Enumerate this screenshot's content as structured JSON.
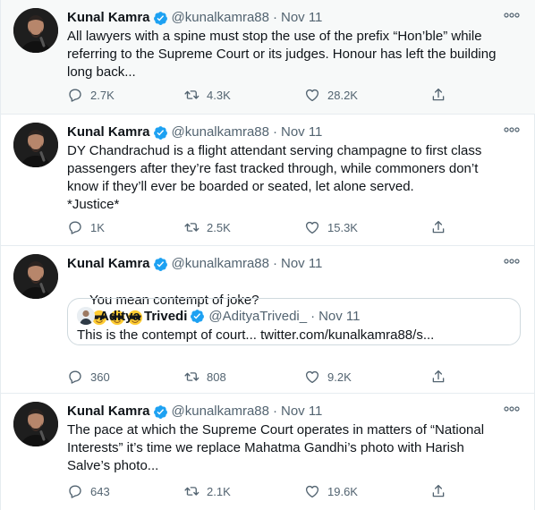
{
  "tweets": [
    {
      "author": "Kunal Kamra",
      "handle": "@kunalkamra88",
      "date": "Nov 11",
      "text": "All lawyers with a spine must stop the use of the prefix “Hon’ble” while\nreferring to the Supreme Court or its judges. Honour has left the building\nlong back...",
      "replies": "2.7K",
      "retweets": "4.3K",
      "likes": "28.2K"
    },
    {
      "author": "Kunal Kamra",
      "handle": "@kunalkamra88",
      "date": "Nov 11",
      "text": "DY Chandrachud is a flight attendant serving champagne to first class\npassengers after they’re fast tracked through, while commoners don’t\nknow if they’ll ever be boarded or seated, let alone served.\n*Justice*",
      "replies": "1K",
      "retweets": "2.5K",
      "likes": "15.3K"
    },
    {
      "author": "Kunal Kamra",
      "handle": "@kunalkamra88",
      "date": "Nov 11",
      "text": "You mean contempt of joke?",
      "emoji_count": 3,
      "emoji_icon": "smiling-face-with-sunglasses",
      "quote": {
        "author": "Aditya Trivedi",
        "handle": "@AdityaTrivedi_",
        "date": "Nov 11",
        "text": "This is the contempt of court... twitter.com/kunalkamra88/s..."
      },
      "replies": "360",
      "retweets": "808",
      "likes": "9.2K"
    },
    {
      "author": "Kunal Kamra",
      "handle": "@kunalkamra88",
      "date": "Nov 11",
      "text": "The pace at which the Supreme Court operates in matters of “National\nInterests” it’s time we replace Mahatma Gandhi’s photo with Harish\nSalve’s photo...",
      "replies": "643",
      "retweets": "2.1K",
      "likes": "19.6K"
    }
  ],
  "separator": "·",
  "colors": {
    "verified": "#1da1f2",
    "secondary_text": "#536471",
    "border": "#e6ecf0",
    "first_tweet_background": "#f7f9f9"
  },
  "icons": {
    "reply": "reply-icon",
    "retweet": "retweet-icon",
    "like": "like-icon",
    "share": "share-icon",
    "more": "more-icon",
    "verified": "verified-badge-icon"
  }
}
